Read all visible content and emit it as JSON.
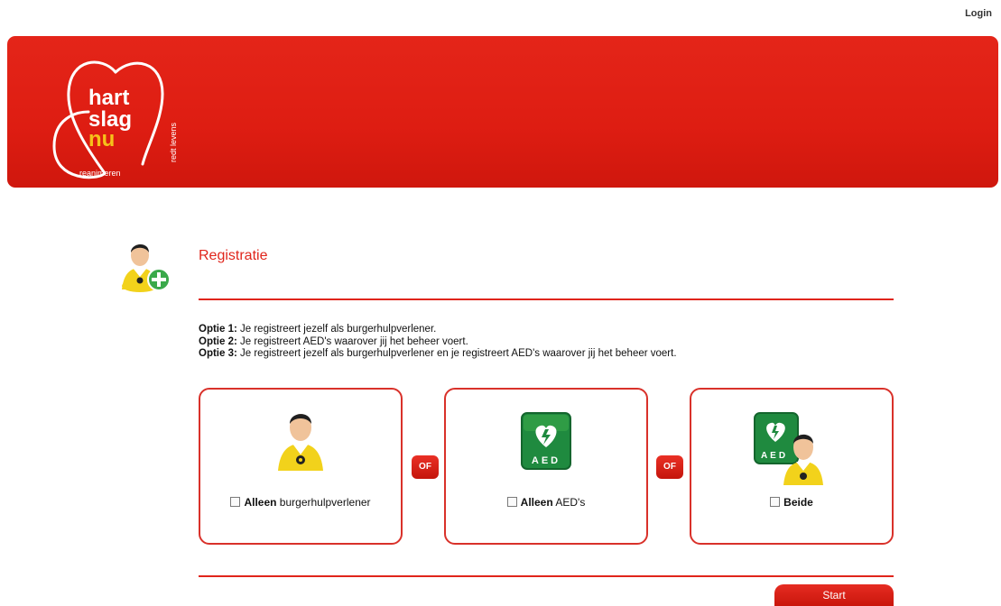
{
  "header": {
    "login_label": "Login"
  },
  "logo": {
    "word1": "hart",
    "word2": "slag",
    "word3": "nu",
    "tagline_vertical": "redt levens",
    "tagline_bottom": "reanimeren"
  },
  "registration": {
    "title": "Registratie",
    "options": [
      {
        "label": "Optie 1:",
        "text": " Je registreert jezelf als burgerhulpverlener."
      },
      {
        "label": "Optie 2:",
        "text": " Je registreert AED's waarover jij het beheer voert."
      },
      {
        "label": "Optie 3:",
        "text": " Je registreert jezelf als burgerhulpverlener en je registreert AED's waarover jij het beheer voert."
      }
    ]
  },
  "cards": [
    {
      "bold": "Alleen",
      "text": " burgerhulpverlener",
      "icon": "person-icon",
      "checked": false
    },
    {
      "bold": "Alleen",
      "text": " AED's",
      "icon": "aed-icon",
      "checked": false
    },
    {
      "bold": "Beide",
      "text": "",
      "icon": "aed-person-icon",
      "checked": false
    }
  ],
  "separator_label": "OF",
  "start_label": "Start",
  "aed_text": "AED",
  "colors": {
    "brand_red": "#e0251b",
    "banner_red": "#de1d12",
    "vest_yellow": "#f2d21b",
    "aed_green": "#1f8a3f"
  }
}
